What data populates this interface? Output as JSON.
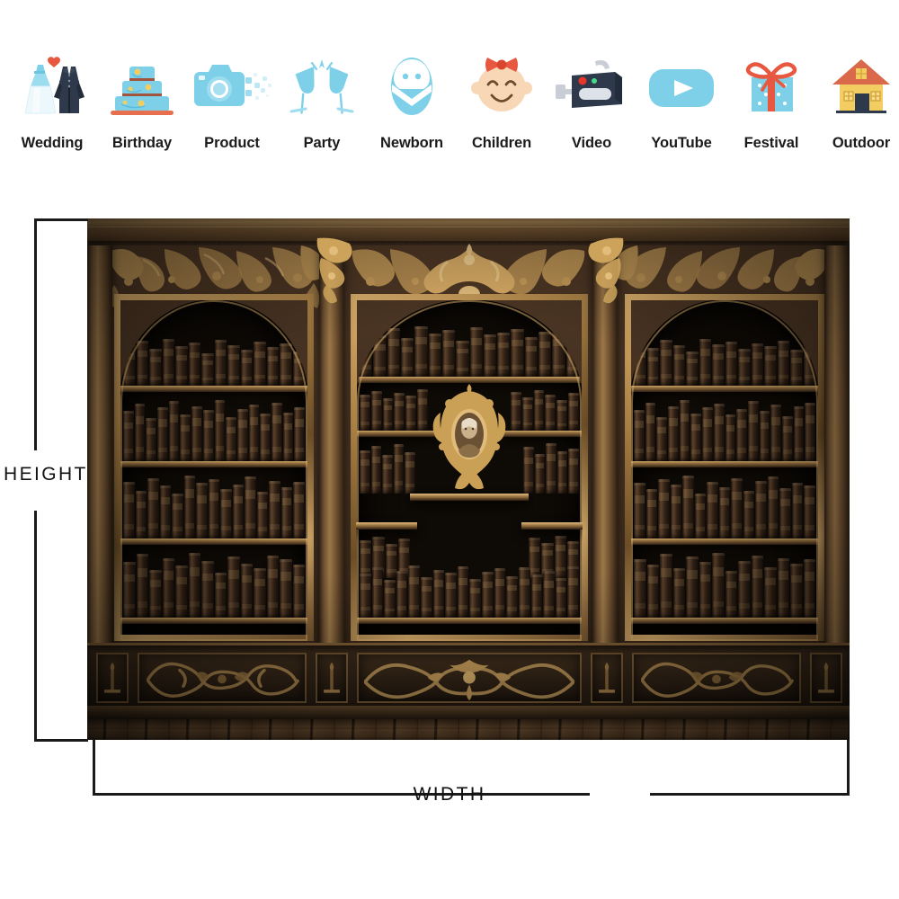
{
  "categories": [
    {
      "label": "Wedding",
      "icon": "wedding-dress-suit-icon"
    },
    {
      "label": "Birthday",
      "icon": "birthday-cake-icon"
    },
    {
      "label": "Product",
      "icon": "camera-icon"
    },
    {
      "label": "Party",
      "icon": "champagne-glasses-icon"
    },
    {
      "label": "Newborn",
      "icon": "swaddled-baby-icon"
    },
    {
      "label": "Children",
      "icon": "child-face-bow-icon"
    },
    {
      "label": "Video",
      "icon": "video-camera-icon"
    },
    {
      "label": "YouTube",
      "icon": "youtube-play-icon"
    },
    {
      "label": "Festival",
      "icon": "gift-box-icon"
    },
    {
      "label": "Outdoor",
      "icon": "house-icon"
    }
  ],
  "measurements": {
    "height_label": "HEIGHT",
    "width_label": "WIDTH"
  },
  "product_photo": {
    "alt": "Ornate antique library bookshelf backdrop with three arched bookcases, gold carvings and oval portrait",
    "scene": "vintage-library-backdrop"
  },
  "colors": {
    "icon_blue": "#7ED0E8",
    "icon_red": "#E8573F",
    "icon_yellow": "#F2CE62",
    "icon_dark_navy": "#2E3A4B",
    "icon_skin": "#F7D7B5",
    "label_text": "#1b1b1b",
    "bracket_line": "#1a1a1a",
    "page_background": "#ffffff",
    "wood_brown": "#4a3424",
    "gold_accent": "#caa367"
  }
}
